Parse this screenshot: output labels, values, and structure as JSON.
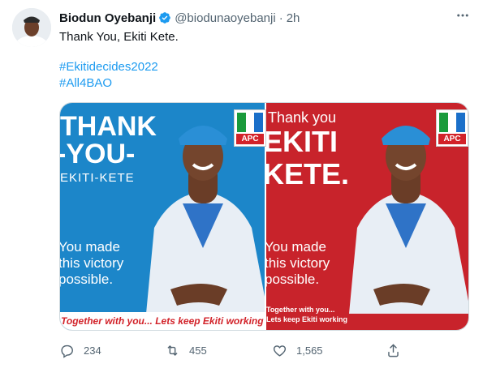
{
  "tweet": {
    "author_name": "Biodun Oyebanji",
    "handle": "@biodunaoyebanji",
    "separator": "·",
    "time": "2h",
    "text": "Thank You, Ekiti Kete.",
    "hashtags": [
      "#Ekitidecides2022",
      "#All4BAO"
    ]
  },
  "media": {
    "left": {
      "headline_1": "THANK",
      "headline_2": "-YOU-",
      "subline": "EKITI-KETE",
      "body": [
        "You made",
        "this victory",
        "possible."
      ],
      "footer": "Together with you... Lets keep Ekiti working",
      "logo_label": "APC",
      "bg_color": "#1c86c9"
    },
    "right": {
      "pre": "Thank you",
      "headline_1": "EKITI",
      "headline_2": "KETE.",
      "body": [
        "You made",
        "this victory",
        "possible."
      ],
      "footer_1": "Together with you...",
      "footer_2": "Lets keep Ekiti working",
      "logo_label": "APC",
      "bg_color": "#c8232b"
    }
  },
  "actions": {
    "reply_count": "234",
    "retweet_count": "455",
    "like_count": "1,565"
  },
  "icons": {
    "verified": "verified-badge-icon",
    "more": "more-icon",
    "reply": "reply-icon",
    "retweet": "retweet-icon",
    "like": "like-icon",
    "share": "share-icon"
  },
  "colors": {
    "link": "#1d9bf0",
    "secondary": "#536471",
    "verified": "#1d9bf0"
  }
}
